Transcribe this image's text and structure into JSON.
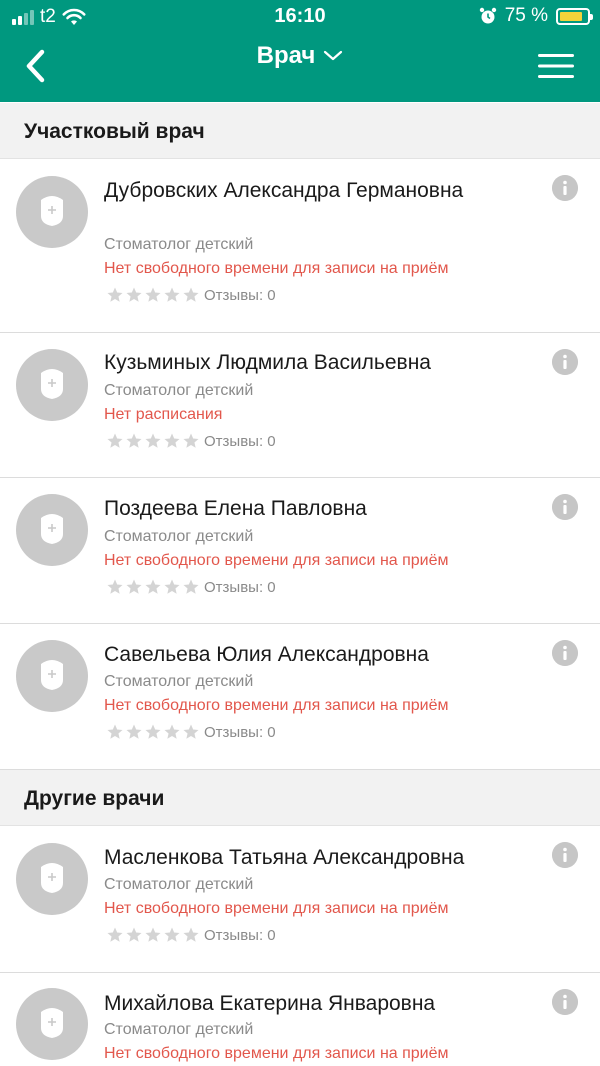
{
  "status_bar": {
    "carrier": "t2",
    "time": "16:10",
    "battery_percent": "75 %"
  },
  "nav": {
    "title": "Врач",
    "back_icon": "chevron-left-icon",
    "menu_icon": "hamburger-menu-icon"
  },
  "colors": {
    "header": "#00987f",
    "status_red": "#e2574c",
    "secondary_text": "#8a8a8a"
  },
  "sections": [
    {
      "title": "Участковый врач"
    },
    {
      "title": "Другие врачи"
    }
  ],
  "doctors": [
    {
      "name": "Дубровских Александра Германовна",
      "specialty": "Стоматолог детский",
      "status": "Нет свободного времени для записи на приём",
      "reviews_label": "Отзывы: 0",
      "rating": 0
    },
    {
      "name": "Кузьминых Людмила Васильевна",
      "specialty": "Стоматолог детский",
      "status": "Нет расписания",
      "reviews_label": "Отзывы: 0",
      "rating": 0
    },
    {
      "name": "Поздеева Елена Павловна",
      "specialty": "Стоматолог детский",
      "status": "Нет свободного времени для записи на приём",
      "reviews_label": "Отзывы: 0",
      "rating": 0
    },
    {
      "name": "Савельева Юлия Александровна",
      "specialty": "Стоматолог детский",
      "status": "Нет свободного времени для записи на приём",
      "reviews_label": "Отзывы: 0",
      "rating": 0
    },
    {
      "name": "Масленкова Татьяна Александровна",
      "specialty": "Стоматолог детский",
      "status": "Нет свободного времени для записи на приём",
      "reviews_label": "Отзывы: 0",
      "rating": 0
    },
    {
      "name": "Михайлова Екатерина Январовна",
      "specialty": "Стоматолог детский",
      "status": "Нет свободного времени для записи на приём",
      "rating": 0
    }
  ]
}
